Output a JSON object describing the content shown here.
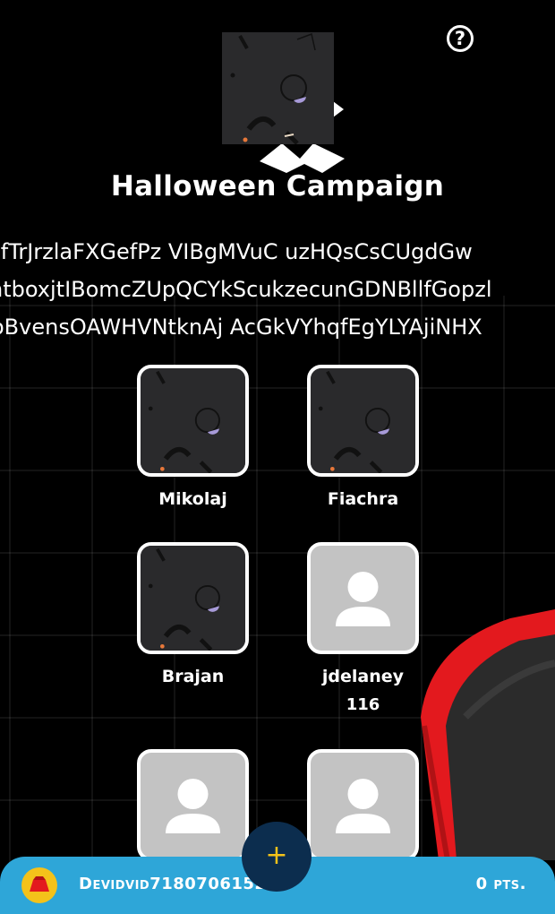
{
  "campaign": {
    "title": "Halloween Campaign",
    "description_lines": [
      "efTrJrzlaFXGefPz VIBgMVuC uzHQsCsCUgdGw",
      "ntboxjtIBomcZUpQCYkScukzecunGDNBllfGopzl",
      "oBvensOAWHVNtknAj AcGkVYhqfEgYLYAjiNHX"
    ],
    "logo_icon": "campaign-pattern-logo"
  },
  "help_label": "?",
  "players": [
    {
      "name": "Mikolaj",
      "score": "",
      "avatar": "pattern"
    },
    {
      "name": "Fiachra",
      "score": "",
      "avatar": "pattern"
    },
    {
      "name": "Brajan",
      "score": "",
      "avatar": "pattern"
    },
    {
      "name": "jdelaney",
      "score": "116",
      "avatar": "default-user"
    },
    {
      "name": "",
      "score": "",
      "avatar": "default-user"
    },
    {
      "name": "",
      "score": "",
      "avatar": "default-user"
    }
  ],
  "user_bar": {
    "username": "Devidvid7180706152",
    "points": "0 pts.",
    "avatar_icon": "coin-hat-icon"
  },
  "add_button_label": "+",
  "colors": {
    "background": "#000000",
    "bar": "#2ea6d8",
    "add_button": "#0c2d4e",
    "accent_yellow": "#f4c21a",
    "mascot_red": "#e3191e"
  }
}
